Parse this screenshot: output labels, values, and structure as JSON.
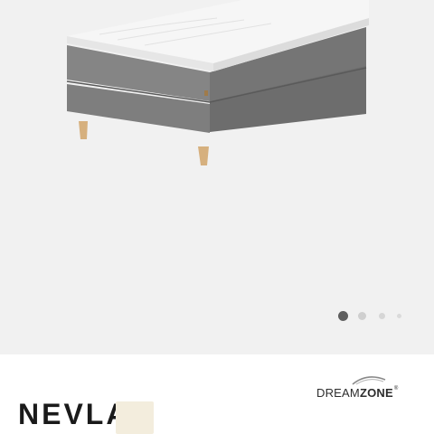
{
  "gallery": {
    "image_alt": "Grey continental bed with white mattress topper and wooden legs",
    "pager": {
      "slide_count": 4,
      "active_index": 0
    }
  },
  "brand": {
    "part1": "DREAM",
    "part2": "ZONE",
    "registered": "®"
  },
  "product": {
    "title": "NEVLA",
    "badge_text": ""
  },
  "colors": {
    "fabric": "#7c7c7c",
    "topper": "#f4f4f4",
    "legs": "#d6b07e",
    "gallery_bg": "#f1f1f1",
    "pager_active": "#5e5e5e",
    "badge_bg": "#f3eddd"
  }
}
